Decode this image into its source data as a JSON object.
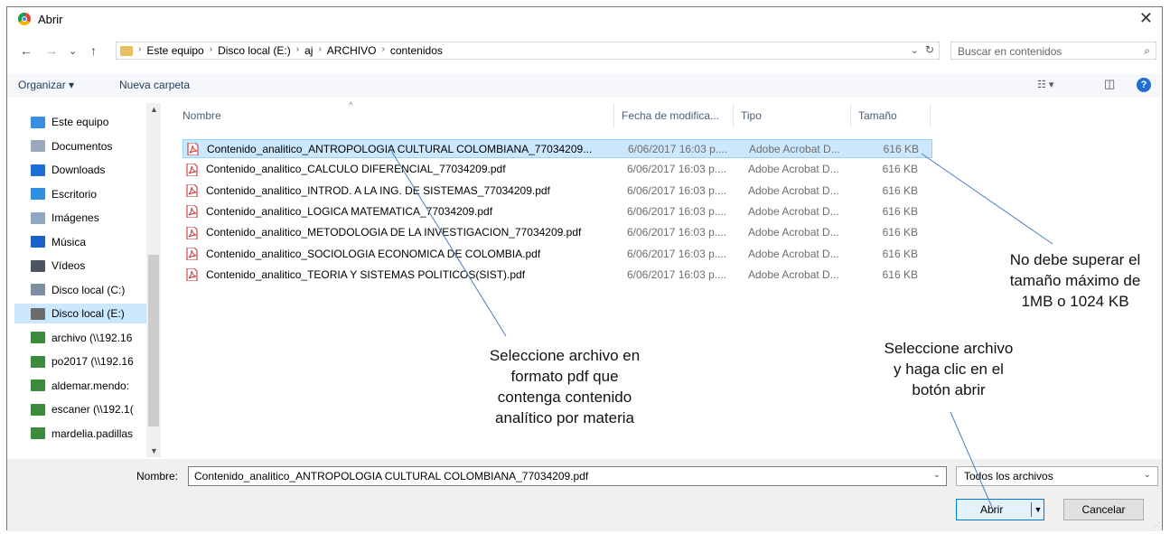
{
  "window": {
    "title": "Abrir",
    "close_label": "✕"
  },
  "nav_buttons": {
    "back": "←",
    "forward": "→",
    "recent": "⌄",
    "up": "↑"
  },
  "address": {
    "crumbs": [
      "Este equipo",
      "Disco local (E:)",
      "aj",
      "ARCHIVO",
      "contenidos"
    ],
    "separator": "›",
    "dropdown": "⌄",
    "refresh": "↻"
  },
  "search": {
    "placeholder": "Buscar en contenidos",
    "icon": "⌕"
  },
  "toolbar": {
    "organize": "Organizar ▾",
    "new_folder": "Nueva carpeta",
    "view_icon": "☷ ▾",
    "pane_icon": "◫",
    "help": "?"
  },
  "sidebar": {
    "items": [
      {
        "label": "Este equipo",
        "icon": "computer-icon",
        "color": "#3a8ee6"
      },
      {
        "label": "Documentos",
        "icon": "documents-icon",
        "color": "#9aa9bc"
      },
      {
        "label": "Downloads",
        "icon": "downloads-icon",
        "color": "#1c6fd6"
      },
      {
        "label": "Escritorio",
        "icon": "desktop-icon",
        "color": "#2f8fe0"
      },
      {
        "label": "Imágenes",
        "icon": "pictures-icon",
        "color": "#8fa7c2"
      },
      {
        "label": "Música",
        "icon": "music-icon",
        "color": "#1a62c8"
      },
      {
        "label": "Vídeos",
        "icon": "videos-icon",
        "color": "#4b5563"
      },
      {
        "label": "Disco local (C:)",
        "icon": "drive-c-icon",
        "color": "#7d8ea3"
      },
      {
        "label": "Disco local (E:)",
        "icon": "drive-e-icon",
        "color": "#6b6b6b"
      },
      {
        "label": "archivo (\\\\192.16",
        "icon": "network-drive-icon",
        "color": "#3c8a3c"
      },
      {
        "label": "po2017 (\\\\192.16",
        "icon": "network-drive-icon",
        "color": "#3c8a3c"
      },
      {
        "label": "aldemar.mendo:",
        "icon": "network-drive-icon",
        "color": "#3c8a3c"
      },
      {
        "label": "escaner (\\\\192.1(",
        "icon": "network-drive-icon",
        "color": "#3c8a3c"
      },
      {
        "label": "mardelia.padillas",
        "icon": "network-drive-icon",
        "color": "#3c8a3c"
      }
    ],
    "scroll_up": "▲",
    "scroll_down": "▼"
  },
  "columns": {
    "sort_indicator": "^",
    "name": "Nombre",
    "date": "Fecha de modifica...",
    "type": "Tipo",
    "size": "Tamaño"
  },
  "files": [
    {
      "name": "Contenido_analitico_ANTROPOLOGIA CULTURAL COLOMBIANA_77034209...",
      "date": "6/06/2017 16:03 p....",
      "type": "Adobe Acrobat D...",
      "size": "616 KB"
    },
    {
      "name": "Contenido_analitico_CALCULO DIFERENCIAL_77034209.pdf",
      "date": "6/06/2017 16:03 p....",
      "type": "Adobe Acrobat D...",
      "size": "616 KB"
    },
    {
      "name": "Contenido_analitico_INTROD. A LA ING. DE SISTEMAS_77034209.pdf",
      "date": "6/06/2017 16:03 p....",
      "type": "Adobe Acrobat D...",
      "size": "616 KB"
    },
    {
      "name": "Contenido_analitico_LOGICA MATEMATICA_77034209.pdf",
      "date": "6/06/2017 16:03 p....",
      "type": "Adobe Acrobat D...",
      "size": "616 KB"
    },
    {
      "name": "Contenido_analitico_METODOLOGIA DE LA INVESTIGACION_77034209.pdf",
      "date": "6/06/2017 16:03 p....",
      "type": "Adobe Acrobat D...",
      "size": "616 KB"
    },
    {
      "name": "Contenido_analitico_SOCIOLOGIA ECONOMICA DE COLOMBIA.pdf",
      "date": "6/06/2017 16:03 p....",
      "type": "Adobe Acrobat D...",
      "size": "616 KB"
    },
    {
      "name": "Contenido_analitico_TEORIA Y SISTEMAS POLITICOS(SIST).pdf",
      "date": "6/06/2017 16:03 p....",
      "type": "Adobe Acrobat D...",
      "size": "616 KB"
    }
  ],
  "selected_index": 0,
  "bottom": {
    "filename_label": "Nombre:",
    "filename_value": "Contenido_analitico_ANTROPOLOGIA CULTURAL COLOMBIANA_77034209.pdf",
    "filter": "Todos los archivos",
    "open": "Abrir",
    "cancel": "Cancelar",
    "dropdown": "⌄"
  },
  "annotations": {
    "size_note": [
      "No debe superar el",
      "tamaño máximo de",
      "1MB o 1024 KB"
    ],
    "select_note": [
      "Seleccione archivo en",
      "formato pdf que",
      "contenga contenido",
      "analítico por materia"
    ],
    "open_note": [
      "Seleccione archivo",
      "y haga clic en el",
      "botón abrir"
    ]
  },
  "colors": {
    "accent": "#0078d7",
    "selection": "#cce8ff",
    "annotation_line": "#4a7fc1",
    "pdf_red": "#d32f2f"
  }
}
